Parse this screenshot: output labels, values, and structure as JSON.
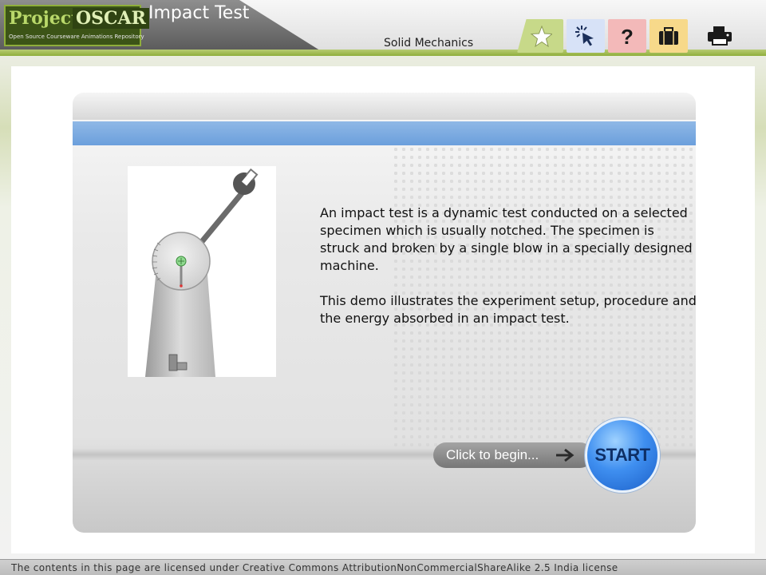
{
  "header": {
    "logo": {
      "word1": "Project",
      "word2": "OSCAR",
      "tagline": "Open Source Courseware Animations Repository"
    },
    "title": "Impact Test",
    "subject": "Solid Mechanics",
    "toolbar": [
      {
        "icon": "star-icon",
        "color": "#c7d989"
      },
      {
        "icon": "pointer-click-icon",
        "color": "#d7e2f7"
      },
      {
        "icon": "question-icon",
        "color": "#f3b9b9"
      },
      {
        "icon": "briefcase-icon",
        "color": "#f7d98a"
      },
      {
        "icon": "printer-icon",
        "color": "#ffffff"
      }
    ]
  },
  "content": {
    "description": [
      "An impact test is a dynamic test conducted on a selected specimen which is usually notched. The specimen is struck and broken by a single blow in a specially designed machine.",
      "This demo illustrates the experiment setup, procedure and the energy absorbed in an impact test."
    ],
    "begin_label": "Click to begin...",
    "start_label": "START"
  },
  "footer": {
    "license": "The contents in this page are licensed under Creative Commons AttributionNonCommercialShareAlike 2.5 India license"
  },
  "colors": {
    "accent_green": "#8fae3b",
    "accent_blue": "#6b9fdc",
    "start_blue": "#3f8ff0"
  }
}
